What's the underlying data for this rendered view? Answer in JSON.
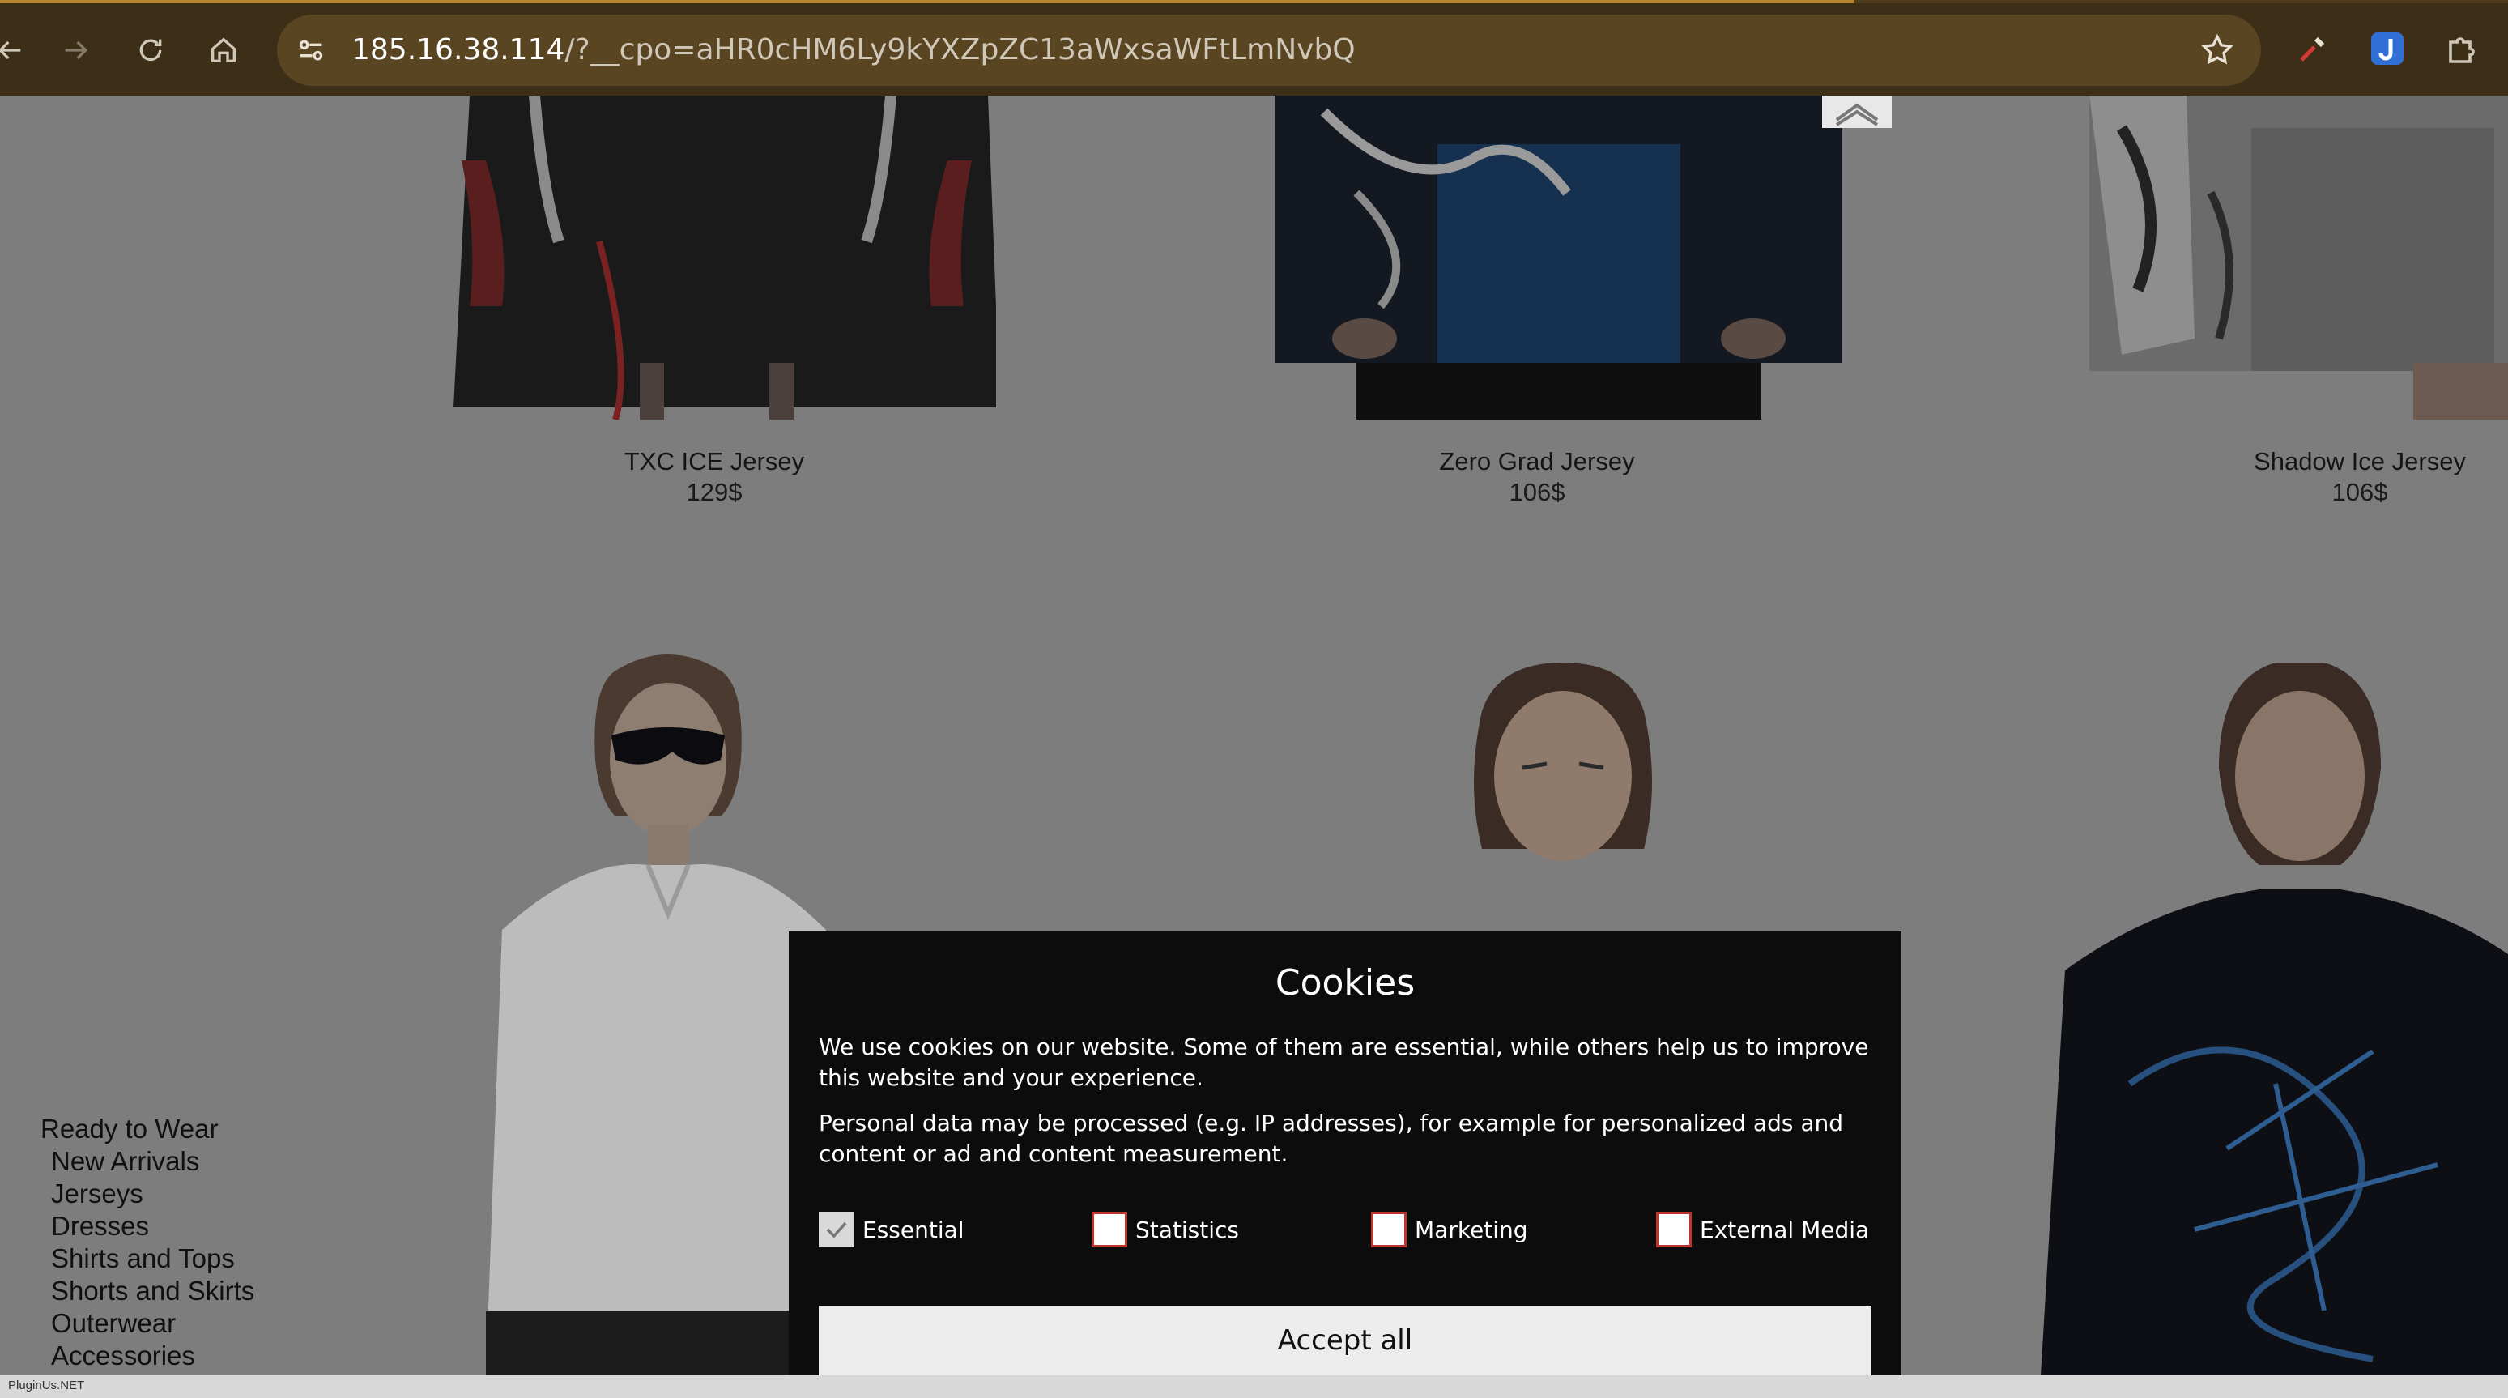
{
  "browser": {
    "url_host": "185.16.38.114",
    "url_path": "/?__cpo=aHR0cHM6Ly9kYXZpZC13aWxsaWFtLmNvbQ"
  },
  "products_row1": [
    {
      "name": "TXC ICE Jersey",
      "price": "129$"
    },
    {
      "name": "Zero Grad Jersey",
      "price": "106$"
    },
    {
      "name": "Shadow Ice Jersey",
      "price": "106$"
    }
  ],
  "menu": {
    "heading": "Ready to Wear",
    "items": [
      "New Arrivals",
      "Jerseys",
      "Dresses",
      "Shirts and Tops",
      "Shorts and Skirts",
      "Outerwear",
      "Accessories"
    ]
  },
  "cookie": {
    "title": "Cookies",
    "p1": "We use cookies on our website. Some of them are essential, while others help us to improve this website and your experience.",
    "p2": "Personal data may be processed (e.g. IP addresses), for example for personalized ads and content or ad and content measurement.",
    "options": [
      {
        "label": "Essential",
        "checked": true
      },
      {
        "label": "Statistics",
        "checked": false
      },
      {
        "label": "Marketing",
        "checked": false
      },
      {
        "label": "External Media",
        "checked": false
      }
    ],
    "accept_label": "Accept all"
  },
  "status_text": "PluginUs.NET"
}
